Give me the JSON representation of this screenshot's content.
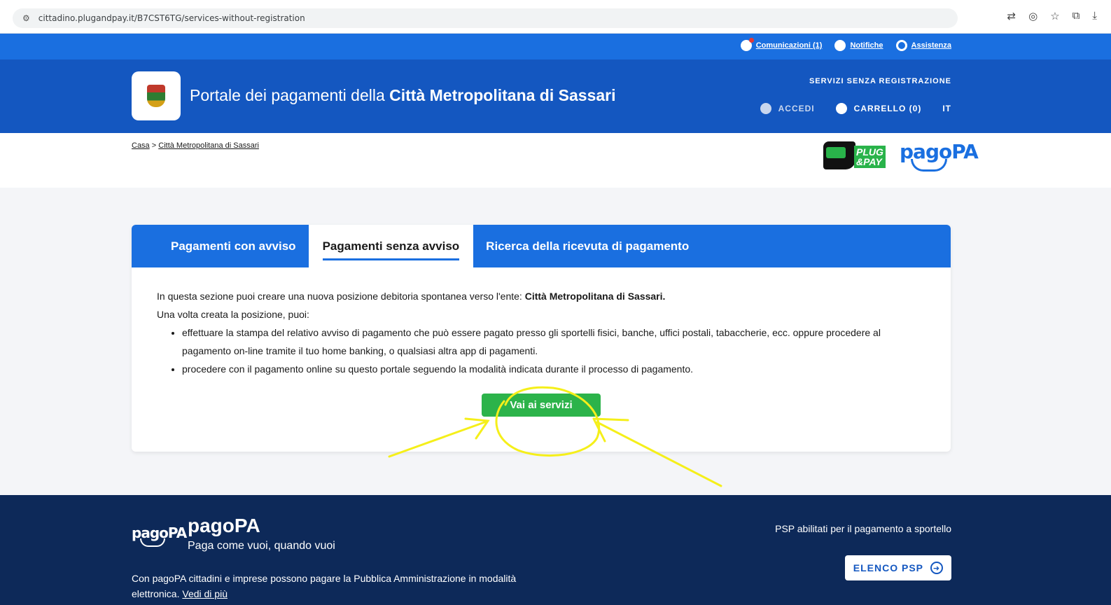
{
  "browser": {
    "url": "cittadino.plugandpay.it/B7CST6TG/services-without-registration"
  },
  "util_bar": {
    "links": [
      "Comunicazioni (1)",
      "Notifiche",
      "Assistenza"
    ]
  },
  "header": {
    "title_prefix": "Portale dei pagamenti della ",
    "title_bold": "Città Metropolitana di Sassari",
    "subtitle": "SERVIZI SENZA REGISTRAZIONE",
    "login": "ACCEDI",
    "cart": "CARRELLO (0)",
    "lang": "IT"
  },
  "breadcrumb": {
    "home": "Casa",
    "separator": ">",
    "current": "Città Metropolitana di Sassari"
  },
  "logos": {
    "plug_line1": "PLUG",
    "plug_line2": "&PAY",
    "pagopa": "pagoPA"
  },
  "tabs": [
    "Pagamenti con avviso",
    "Pagamenti senza avviso",
    "Ricerca della ricevuta di pagamento"
  ],
  "active_tab": "Pagamenti senza avviso",
  "content": {
    "intro": "In questa sezione puoi creare una nuova posizione debitoria spontanea verso l'ente: ",
    "intro_bold": "Città Metropolitana di Sassari.",
    "line2": "Una volta creata la posizione, puoi:",
    "bullets": [
      "effettuare la stampa del relativo avviso di pagamento che può essere pagato presso gli sportelli fisici, banche, uffici postali, tabaccherie, ecc. oppure procedere al pagamento on-line tramite il tuo home banking, o qualsiasi altra app di pagamenti.",
      "procedere con il pagamento online su questo portale seguendo la modalità indicata durante il processo di pagamento."
    ],
    "button": "Vai ai servizi"
  },
  "footer": {
    "logo": "pagoPA",
    "brand": "pagoPA",
    "tagline": "Paga come vuoi, quando vuoi",
    "description": "Con pagoPA cittadini e imprese possono pagare la Pubblica Amministrazione in modalità elettronica. ",
    "more_link": "Vedi di più",
    "psp_text": "PSP abilitati per il pagamento a sportello",
    "psp_button": "ELENCO PSP"
  },
  "colors": {
    "primary": "#1a6fe0",
    "header": "#1457c0",
    "footer": "#0d2959",
    "button_green": "#2cb34a",
    "annotation": "#f5ef1a"
  }
}
